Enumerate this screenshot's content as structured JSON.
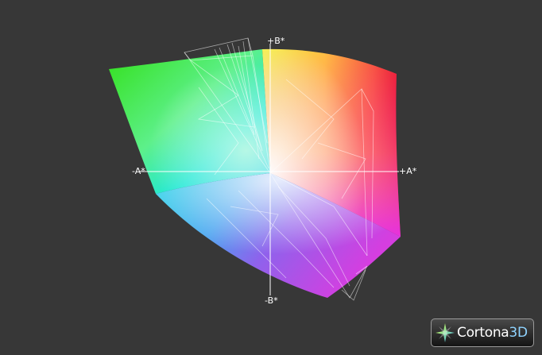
{
  "viewer": {
    "axes": {
      "plus_b": "+B*",
      "minus_b": "-B*",
      "plus_a": "+A*",
      "minus_a": "-A*"
    },
    "background_color": "#373737",
    "logo": {
      "name": "Cortona",
      "suffix": "3D",
      "icon": "cortona-star-icon",
      "accent_color": "#8fd3ff"
    }
  }
}
